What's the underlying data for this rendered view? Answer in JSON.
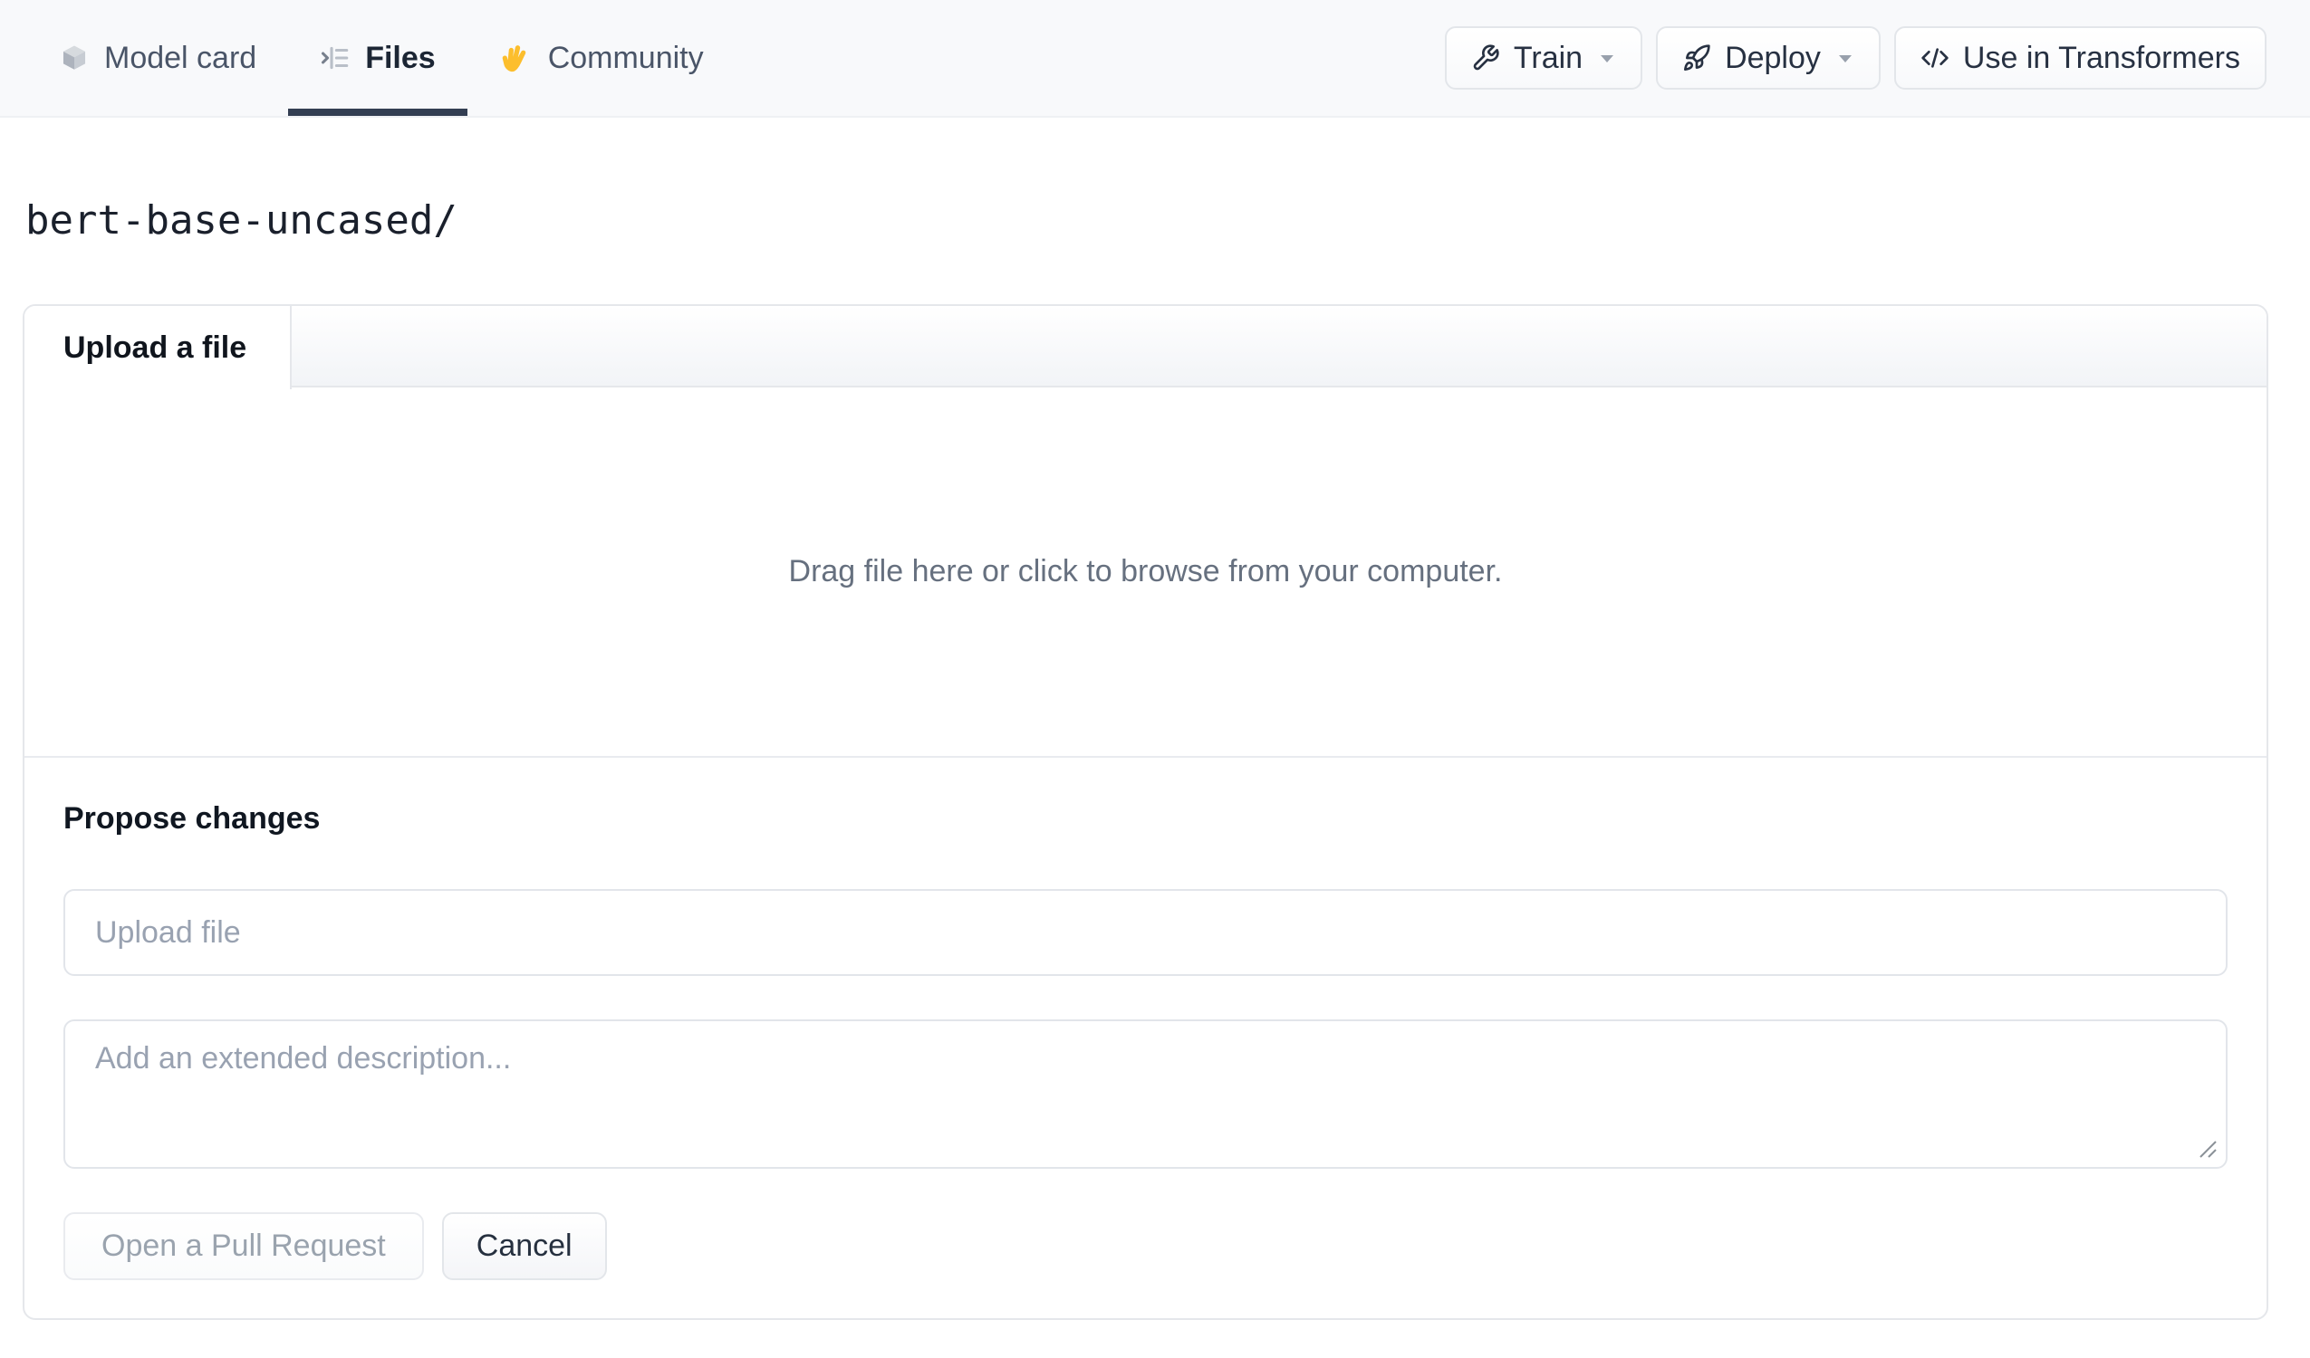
{
  "nav": {
    "tabs": [
      {
        "label": "Model card",
        "icon": "cube-icon",
        "active": false
      },
      {
        "label": "Files",
        "icon": "file-list-icon",
        "active": true
      },
      {
        "label": "Community",
        "icon": "waving-hand-icon",
        "active": false
      }
    ],
    "actions": [
      {
        "label": "Train",
        "icon": "wrench-icon",
        "has_caret": true
      },
      {
        "label": "Deploy",
        "icon": "rocket-icon",
        "has_caret": true
      },
      {
        "label": "Use in Transformers",
        "icon": "code-icon",
        "has_caret": false
      }
    ]
  },
  "breadcrumb": {
    "path": "bert-base-uncased/"
  },
  "upload_card": {
    "tab_label": "Upload a file",
    "dropzone_text": "Drag file here or click to browse from your computer.",
    "propose": {
      "heading": "Propose changes",
      "file_input_placeholder": "Upload file",
      "file_input_value": "",
      "description_placeholder": "Add an extended description...",
      "description_value": "",
      "submit_label": "Open a Pull Request",
      "cancel_label": "Cancel"
    }
  },
  "colors": {
    "active_tab_underline": "#333e52",
    "nav_background": "#f8f9fb",
    "card_border": "#e5e7eb",
    "muted_text": "#66707f",
    "placeholder_text": "#99a2b1",
    "hand_emoji": "#fcbe2d"
  }
}
